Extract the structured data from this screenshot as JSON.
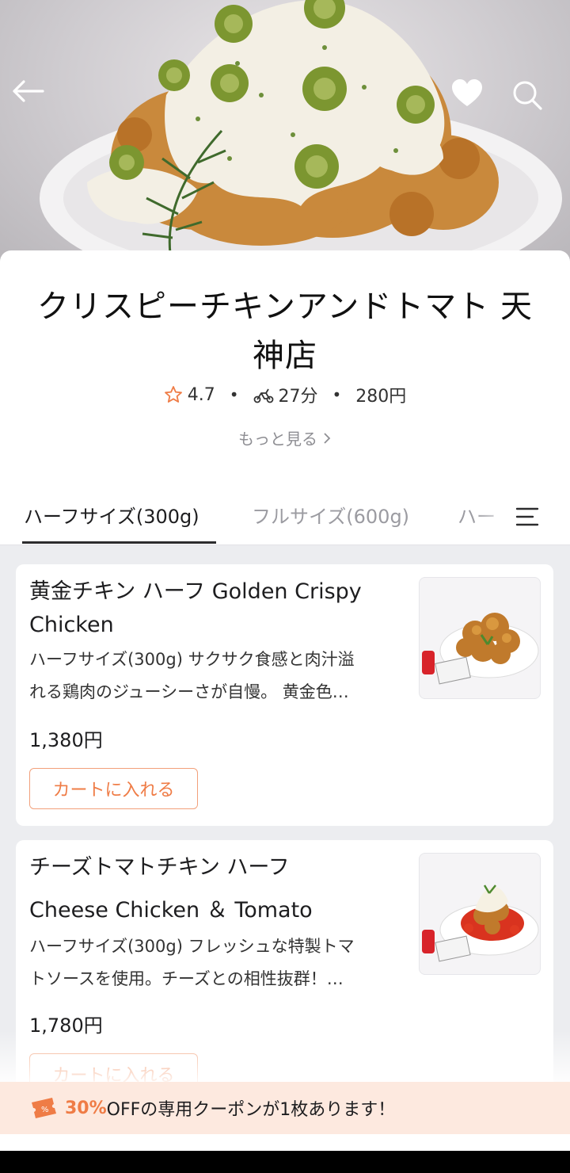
{
  "store": {
    "name_line1": "クリスピーチキンアンドトマト 天",
    "name_line2": "神店",
    "rating": "4.7",
    "delivery_time": "27分",
    "delivery_fee": "280円",
    "more_label": "もっと見る"
  },
  "tabs": [
    {
      "label": "ハーフサイズ(300g)",
      "active": true
    },
    {
      "label": "フルサイズ(600g)",
      "active": false
    },
    {
      "label": "ハー",
      "active": false
    }
  ],
  "items": [
    {
      "name_line1": "黄金チキン ハーフ Golden Crispy",
      "name_line2": "Chicken",
      "desc_line1": "ハーフサイズ(300g) サクサク食感と肉汁溢",
      "desc_line2": "れる鶏肉のジューシーさが自慢。 黄金色…",
      "price": "1,380円",
      "cart_label": "カートに入れる"
    },
    {
      "name_line1": "チーズトマトチキン ハーフ",
      "name_line2": "Cheese Chicken ＆ Tomato",
      "desc_line1": "ハーフサイズ(300g) フレッシュな特製トマ",
      "desc_line2": "トソースを使用。チーズとの相性抜群！…",
      "price": "1,780円",
      "cart_label": "カートに入れる"
    }
  ],
  "coupon": {
    "percent": "30%",
    "text": "OFFの専用クーポンが1枚あります！"
  },
  "colors": {
    "accent": "#ef7c46",
    "coupon_bg": "#fde9df"
  }
}
